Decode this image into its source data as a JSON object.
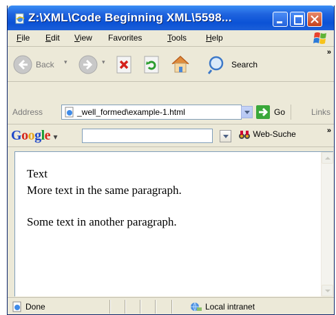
{
  "window": {
    "title": "Z:\\XML\\Code Beginning XML\\5598..."
  },
  "menu": {
    "items": [
      {
        "first": "F",
        "rest": "ile"
      },
      {
        "first": "E",
        "rest": "dit"
      },
      {
        "first": "V",
        "rest": "iew"
      },
      {
        "first": "F",
        "rest": "avorites",
        "pre": "",
        "under_index": 1
      },
      {
        "first": "T",
        "rest": "ools"
      },
      {
        "first": "H",
        "rest": "elp"
      }
    ]
  },
  "toolbar": {
    "back_label": "Back",
    "search_label": "Search",
    "more_chevron": "»"
  },
  "address": {
    "label": "Address",
    "value": "_well_formed\\example-1.html",
    "go_label": "Go",
    "links_label": "Links"
  },
  "google": {
    "logo_letters": [
      "G",
      "o",
      "o",
      "g",
      "l",
      "e"
    ],
    "logo_colors": [
      "#1f47c9",
      "#d5261b",
      "#e7a51b",
      "#1f47c9",
      "#139a2f",
      "#d5261b"
    ],
    "dropdown_glyph": "▾",
    "websearch_label": "Web-Suche",
    "more_chevron": "»"
  },
  "page": {
    "paragraphs": [
      [
        "Text",
        "More text in the same paragraph."
      ],
      [
        "Some text in another paragraph."
      ]
    ]
  },
  "status": {
    "left_text": "Done",
    "zone_text": "Local intranet"
  },
  "colors": {
    "titlebar": "#0b52d6",
    "chrome": "#ece9d8",
    "close": "#c4401c"
  }
}
